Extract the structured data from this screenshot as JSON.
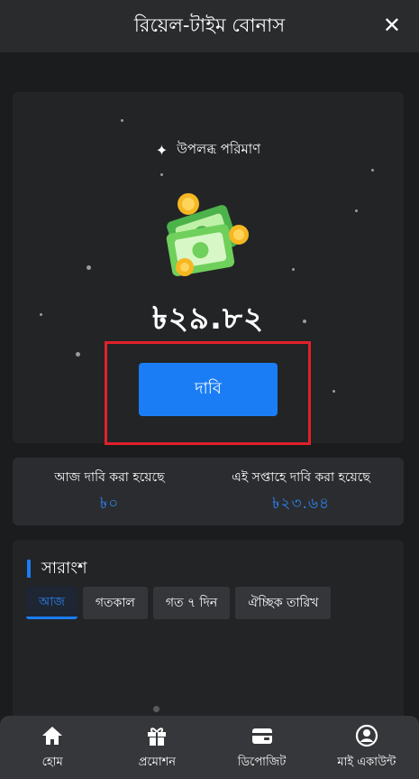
{
  "header": {
    "title": "রিয়েল-টাইম বোনাস",
    "close_icon": "close-icon"
  },
  "bonus": {
    "available_label": "উপলব্ধ পরিমাণ",
    "amount": "৳২৯.৮২",
    "claim_label": "দাবি"
  },
  "stats": {
    "today_label": "আজ দাবি করা হয়েছে",
    "today_value": "৳০",
    "week_label": "এই সপ্তাহে দাবি করা হয়েছে",
    "week_value": "৳২৩.৬৪"
  },
  "summary": {
    "title": "সারাংশ",
    "tabs": [
      {
        "label": "আজ",
        "active": true
      },
      {
        "label": "গতকাল",
        "active": false
      },
      {
        "label": "গত ৭ দিন",
        "active": false
      },
      {
        "label": "ঐচ্ছিক তারিখ",
        "active": false
      }
    ]
  },
  "nav": {
    "items": [
      {
        "label": "হোম",
        "icon": "home-icon"
      },
      {
        "label": "প্রমোশন",
        "icon": "gift-icon"
      },
      {
        "label": "ডিপোজিট",
        "icon": "wallet-icon"
      },
      {
        "label": "মাই একাউন্ট",
        "icon": "account-icon"
      }
    ]
  },
  "colors": {
    "accent": "#1a7df5",
    "highlight": "#e0202a",
    "background": "#1b1c1e"
  }
}
